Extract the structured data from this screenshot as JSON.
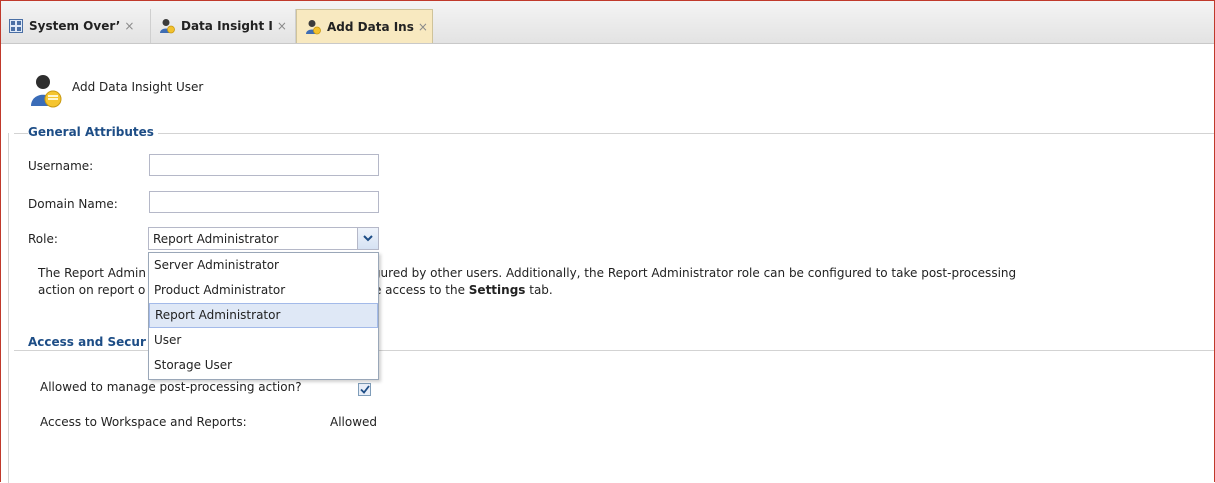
{
  "tabs": [
    {
      "label": "System Over’",
      "icon": "grid-icon",
      "close": "×",
      "active": false
    },
    {
      "label": "Data Insight I",
      "icon": "user-icon",
      "close": "×",
      "active": false
    },
    {
      "label": "Add Data Ins",
      "icon": "user-icon",
      "close": "×",
      "active": true
    }
  ],
  "header": {
    "title": "Add Data Insight User",
    "icon": "add-user-icon"
  },
  "general": {
    "section_title": "General Attributes",
    "username_label": "Username:",
    "username_value": "",
    "domain_label": "Domain Name:",
    "domain_value": "",
    "role_label": "Role:",
    "role_value": "Report Administrator",
    "description_a": "The Report Admin",
    "description_b": "d edit all reports configured by other users. Additionally, the Report Administrator role can be configured to take post-processing",
    "description_c": "action on report o",
    "description_d": "ator role does not have access to the ",
    "description_bold": "Settings",
    "description_e": " tab."
  },
  "role_options": [
    "Server Administrator",
    "Product Administrator",
    "Report Administrator",
    "User",
    "Storage User"
  ],
  "access": {
    "section_title": "Access and Secur",
    "post_processing_label": "Allowed to manage post-processing action?",
    "post_processing_checked": true,
    "workspace_label": "Access to Workspace and Reports:",
    "workspace_value": "Allowed"
  },
  "colors": {
    "accent": "#1d4d86",
    "active_tab": "#f8e9c0",
    "selected_option": "#dfe8f6"
  }
}
